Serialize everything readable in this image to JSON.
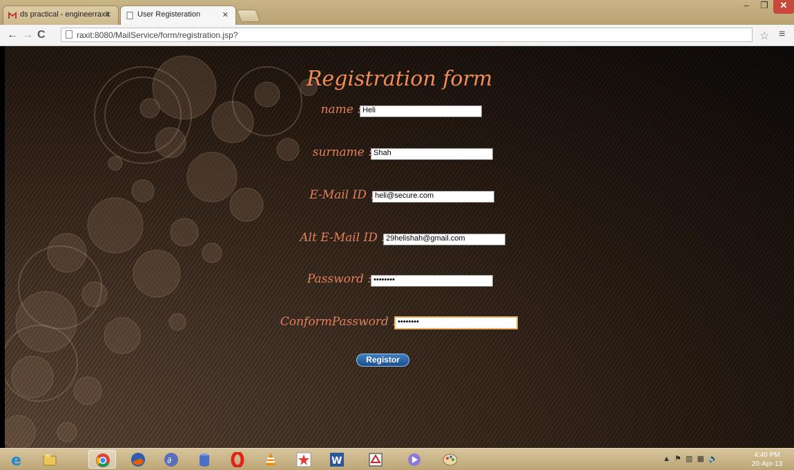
{
  "browser": {
    "tabs": [
      {
        "title": "ds practical - engineerraxit",
        "icon": "gmail-icon"
      },
      {
        "title": "User Registeration",
        "icon": "page-icon"
      }
    ],
    "url": "raxit:8080/MailService/form/registration.jsp?"
  },
  "form": {
    "title": "Registration form",
    "fields": [
      {
        "label": "name :",
        "value": "Heli"
      },
      {
        "label": "surname :",
        "value": "Shah"
      },
      {
        "label": "E-Mail ID :",
        "value": "heli@secure.com"
      },
      {
        "label": "Alt E-Mail ID :",
        "value": "29helishah@gmail.com"
      },
      {
        "label": "Password :",
        "value": "••••••••"
      },
      {
        "label": "ConformPassword :",
        "value": "••••••••"
      }
    ],
    "submit_label": "Registor"
  },
  "taskbar": {
    "apps": [
      "internet-explorer-icon",
      "file-explorer-icon",
      "chrome-icon",
      "firefox-icon",
      "eclipse-icon",
      "database-icon",
      "opera-icon",
      "vlc-icon",
      "star-app-icon",
      "word-icon",
      "draw-app-icon",
      "media-app-icon",
      "paint-icon"
    ],
    "time": "4:40 PM",
    "date": "20-Apr-13"
  }
}
